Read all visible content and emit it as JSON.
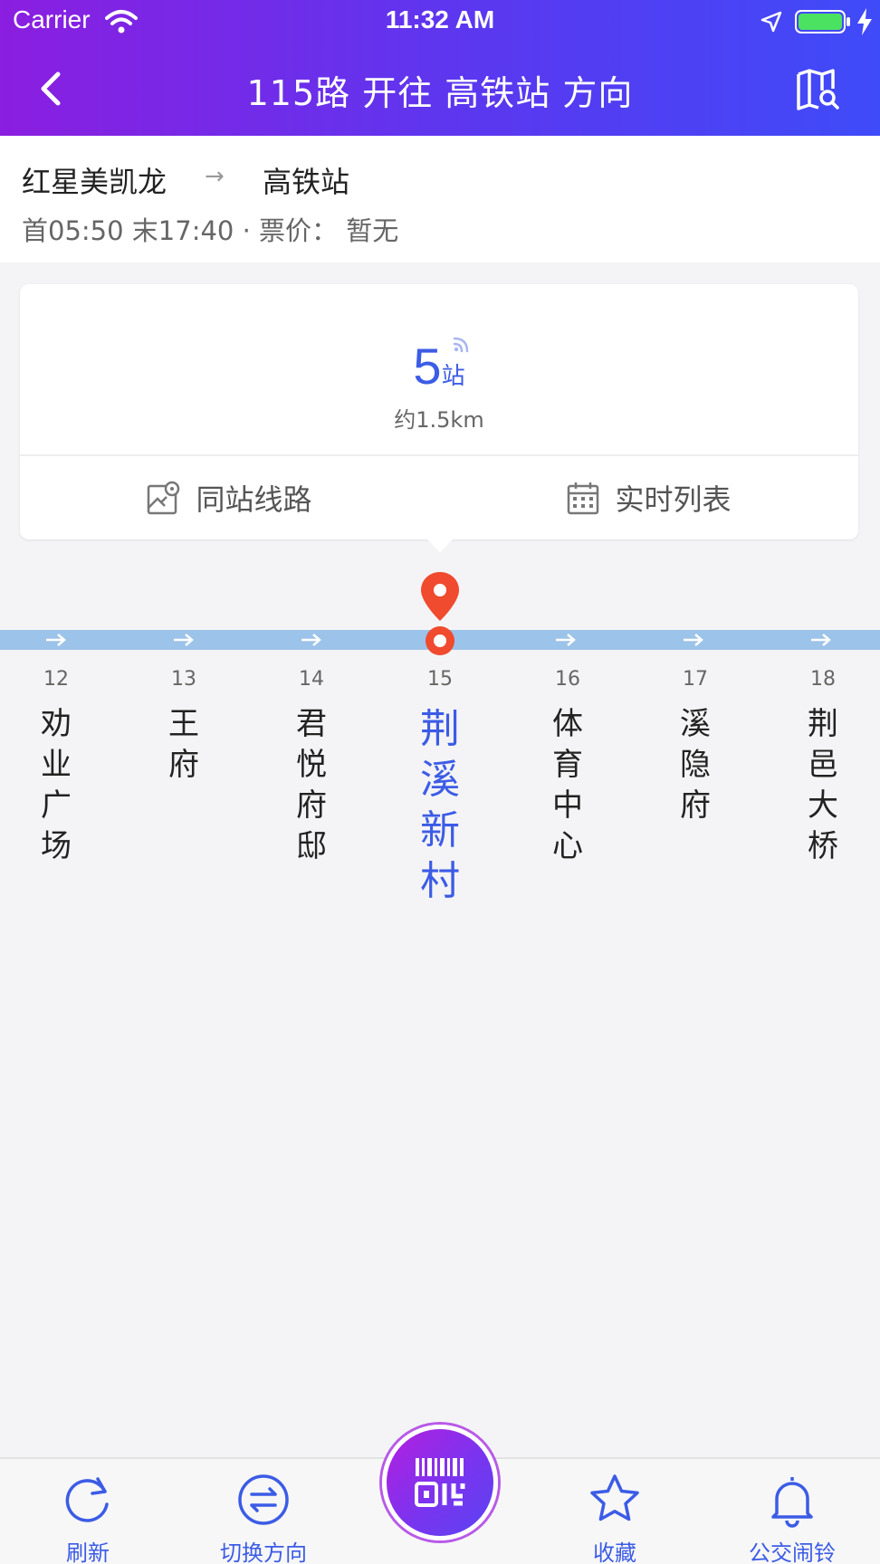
{
  "status_bar": {
    "carrier": "Carrier",
    "time": "11:32 AM"
  },
  "nav": {
    "title": "115路 开往 高铁站 方向",
    "back_icon": "chevron-left-icon",
    "map_icon": "map-search-icon"
  },
  "route": {
    "start": "红星美凯龙",
    "arrow": "→",
    "end": "高铁站",
    "meta": "首05:50 末17:40 · 票价：  暂无"
  },
  "arrival": {
    "stops_count": "5",
    "stops_unit": "站",
    "distance": "约1.5km",
    "same_station_label": "同站线路",
    "realtime_label": "实时列表"
  },
  "stops": [
    {
      "num": "12",
      "name": "劝业广场"
    },
    {
      "num": "13",
      "name": "王府"
    },
    {
      "num": "14",
      "name": "君悦府邸"
    },
    {
      "num": "15",
      "name": "荆溪新村",
      "current": true
    },
    {
      "num": "16",
      "name": "体育中心"
    },
    {
      "num": "17",
      "name": "溪隐府"
    },
    {
      "num": "18",
      "name": "荆邑大桥"
    }
  ],
  "tabs": {
    "refresh": "刷新",
    "switch": "切换方向",
    "favorite": "收藏",
    "alarm": "公交闹铃"
  },
  "colors": {
    "header_gradient_start": "#8b1ee0",
    "header_gradient_end": "#3f4bf8",
    "accent": "#3c5ce6",
    "current_stop": "#f04a2f",
    "line": "#9cc3e9"
  }
}
